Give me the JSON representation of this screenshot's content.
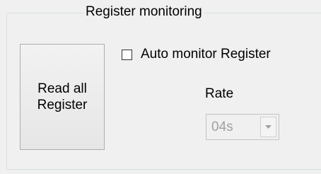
{
  "group": {
    "title": "Register monitoring"
  },
  "read_button": {
    "label": "Read all\nRegister"
  },
  "auto_monitor": {
    "label": "Auto monitor Register",
    "checked": false
  },
  "rate": {
    "label": "Rate",
    "selected": "04s",
    "enabled": false
  },
  "icons": {
    "dropdown_arrow": "chevron-down-icon"
  },
  "colors": {
    "window_bg": "#f0f0f0",
    "group_border": "#d5dfe5",
    "disabled_text": "#a0a0a0"
  }
}
